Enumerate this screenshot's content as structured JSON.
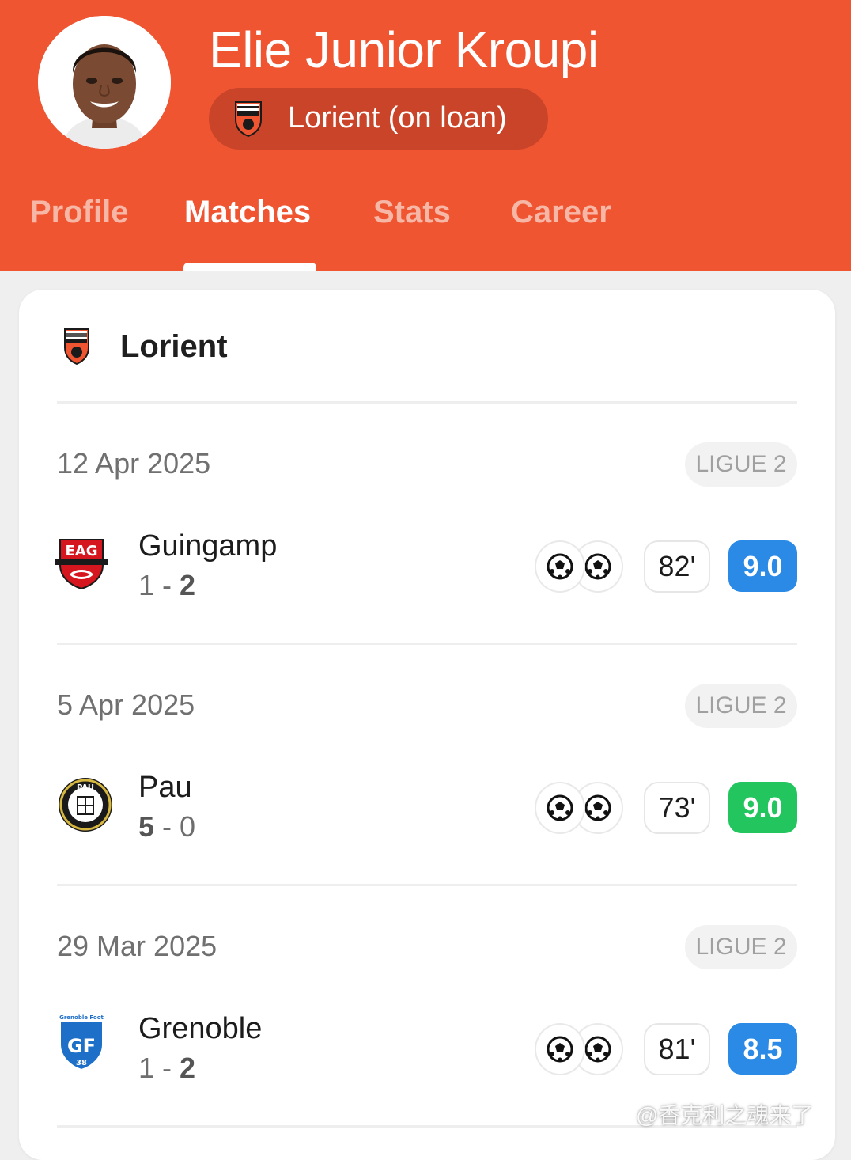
{
  "player": {
    "name": "Elie Junior Kroupi",
    "team_chip": "Lorient (on loan)"
  },
  "tabs": [
    "Profile",
    "Matches",
    "Stats",
    "Career"
  ],
  "active_tab": "Matches",
  "card": {
    "team": "Lorient",
    "matches": [
      {
        "date": "12 Apr 2025",
        "league": "LIGUE 2",
        "opponent": "Guingamp",
        "score_home": "1",
        "score_away": "2",
        "minutes": "82'",
        "rating": "9.0",
        "rating_color": "#2a8ae6",
        "crest": "guingamp-crest"
      },
      {
        "date": "5 Apr 2025",
        "league": "LIGUE 2",
        "opponent": "Pau",
        "score_home": "5",
        "score_away": "0",
        "minutes": "73'",
        "rating": "9.0",
        "rating_color": "#22c55e",
        "crest": "pau-crest"
      },
      {
        "date": "29 Mar 2025",
        "league": "LIGUE 2",
        "opponent": "Grenoble",
        "score_home": "1",
        "score_away": "2",
        "minutes": "81'",
        "rating": "8.5",
        "rating_color": "#2a8ae6",
        "crest": "grenoble-crest"
      }
    ]
  },
  "watermark": "@香克利之魂来了",
  "colors": {
    "header": "#f05532",
    "chip": "#c94428",
    "tab_inactive": "#f6b7a6"
  }
}
